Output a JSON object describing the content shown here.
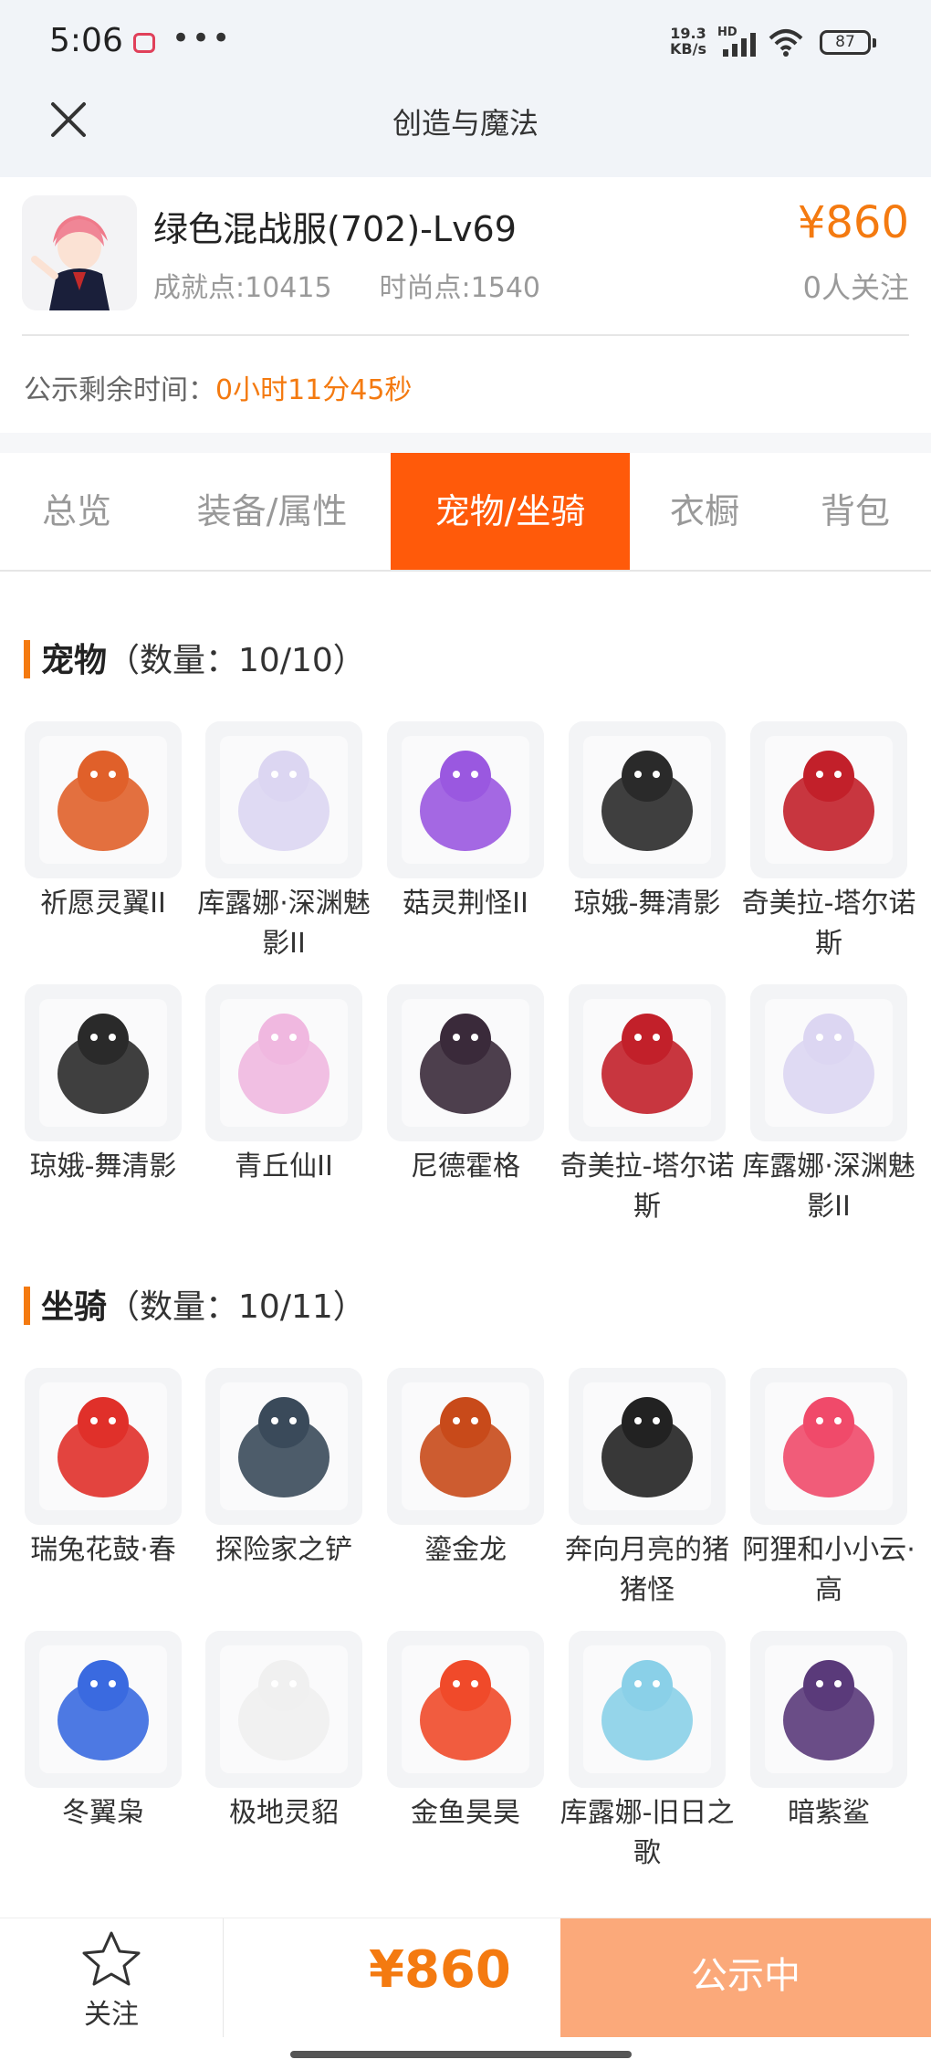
{
  "status_bar": {
    "time": "5:06",
    "speed_value": "19.3",
    "speed_unit": "KB/s",
    "hd": "HD",
    "battery": "87"
  },
  "nav": {
    "title": "创造与魔法"
  },
  "product": {
    "name": "绿色混战服(702)-Lv69",
    "achievement": "成就点:10415",
    "fashion": "时尚点:1540",
    "price": "¥860",
    "followers": "0人关注",
    "remain_label": "公示剩余时间：",
    "remain_value": "0小时11分45秒"
  },
  "tabs": [
    "总览",
    "装备/属性",
    "宠物/坐骑",
    "衣橱",
    "背包"
  ],
  "active_tab": "宠物/坐骑",
  "pets": {
    "title": "宠物",
    "count": "（数量：10/10）",
    "items": [
      {
        "name": "祈愿灵翼II",
        "icon": "griffin-pet-icon",
        "color": "#e0602a"
      },
      {
        "name": "库露娜·深渊魅影II",
        "icon": "kuluna-abyss-pet-icon",
        "color": "#dcd6f2"
      },
      {
        "name": "菇灵荆怪II",
        "icon": "mushroom-spirit-pet-icon",
        "color": "#9a58e0"
      },
      {
        "name": "琼娥-舞清影",
        "icon": "qionge-dancer-pet-icon",
        "color": "#2a2a2a"
      },
      {
        "name": "奇美拉-塔尔诺斯",
        "icon": "chimera-pet-icon",
        "color": "#c2202a"
      },
      {
        "name": "琼娥-舞清影",
        "icon": "qionge-dancer-pet-icon",
        "color": "#2a2a2a"
      },
      {
        "name": "青丘仙II",
        "icon": "fox-fairy-pet-icon",
        "color": "#f0b8e0"
      },
      {
        "name": "尼德霍格",
        "icon": "dark-dragon-pet-icon",
        "color": "#3a2a3a"
      },
      {
        "name": "奇美拉-塔尔诺斯",
        "icon": "chimera-pet-icon",
        "color": "#c2202a"
      },
      {
        "name": "库露娜·深渊魅影II",
        "icon": "kuluna-abyss-pet-icon",
        "color": "#dcd6f2"
      }
    ]
  },
  "mounts": {
    "title": "坐骑",
    "count": "（数量：10/11）",
    "items": [
      {
        "name": "瑞兔花鼓·春",
        "icon": "rabbit-drum-mount-icon",
        "color": "#e0302a"
      },
      {
        "name": "探险家之铲",
        "icon": "shovel-mount-icon",
        "color": "#3a4a5a"
      },
      {
        "name": "鎏金龙",
        "icon": "gilded-dragon-mount-icon",
        "color": "#c84a1a"
      },
      {
        "name": "奔向月亮的猪猪怪",
        "icon": "moon-pig-mount-icon",
        "color": "#222222"
      },
      {
        "name": "阿狸和小小云·高",
        "icon": "ali-cloud-mount-icon",
        "color": "#f04a6a"
      },
      {
        "name": "冬翼枭",
        "icon": "winter-owl-mount-icon",
        "color": "#3a6ae0"
      },
      {
        "name": "极地灵貂",
        "icon": "polar-mink-mount-icon",
        "color": "#f0f0f0"
      },
      {
        "name": "金鱼昊昊",
        "icon": "goldfish-mount-icon",
        "color": "#f04a2a"
      },
      {
        "name": "库露娜-旧日之歌",
        "icon": "kuluna-song-mount-icon",
        "color": "#8ad0e8"
      },
      {
        "name": "暗紫鲨",
        "icon": "purple-shark-mount-icon",
        "color": "#5a3a7a"
      }
    ]
  },
  "bottom": {
    "follow_label": "关注",
    "price": "¥860",
    "status": "公示中"
  }
}
